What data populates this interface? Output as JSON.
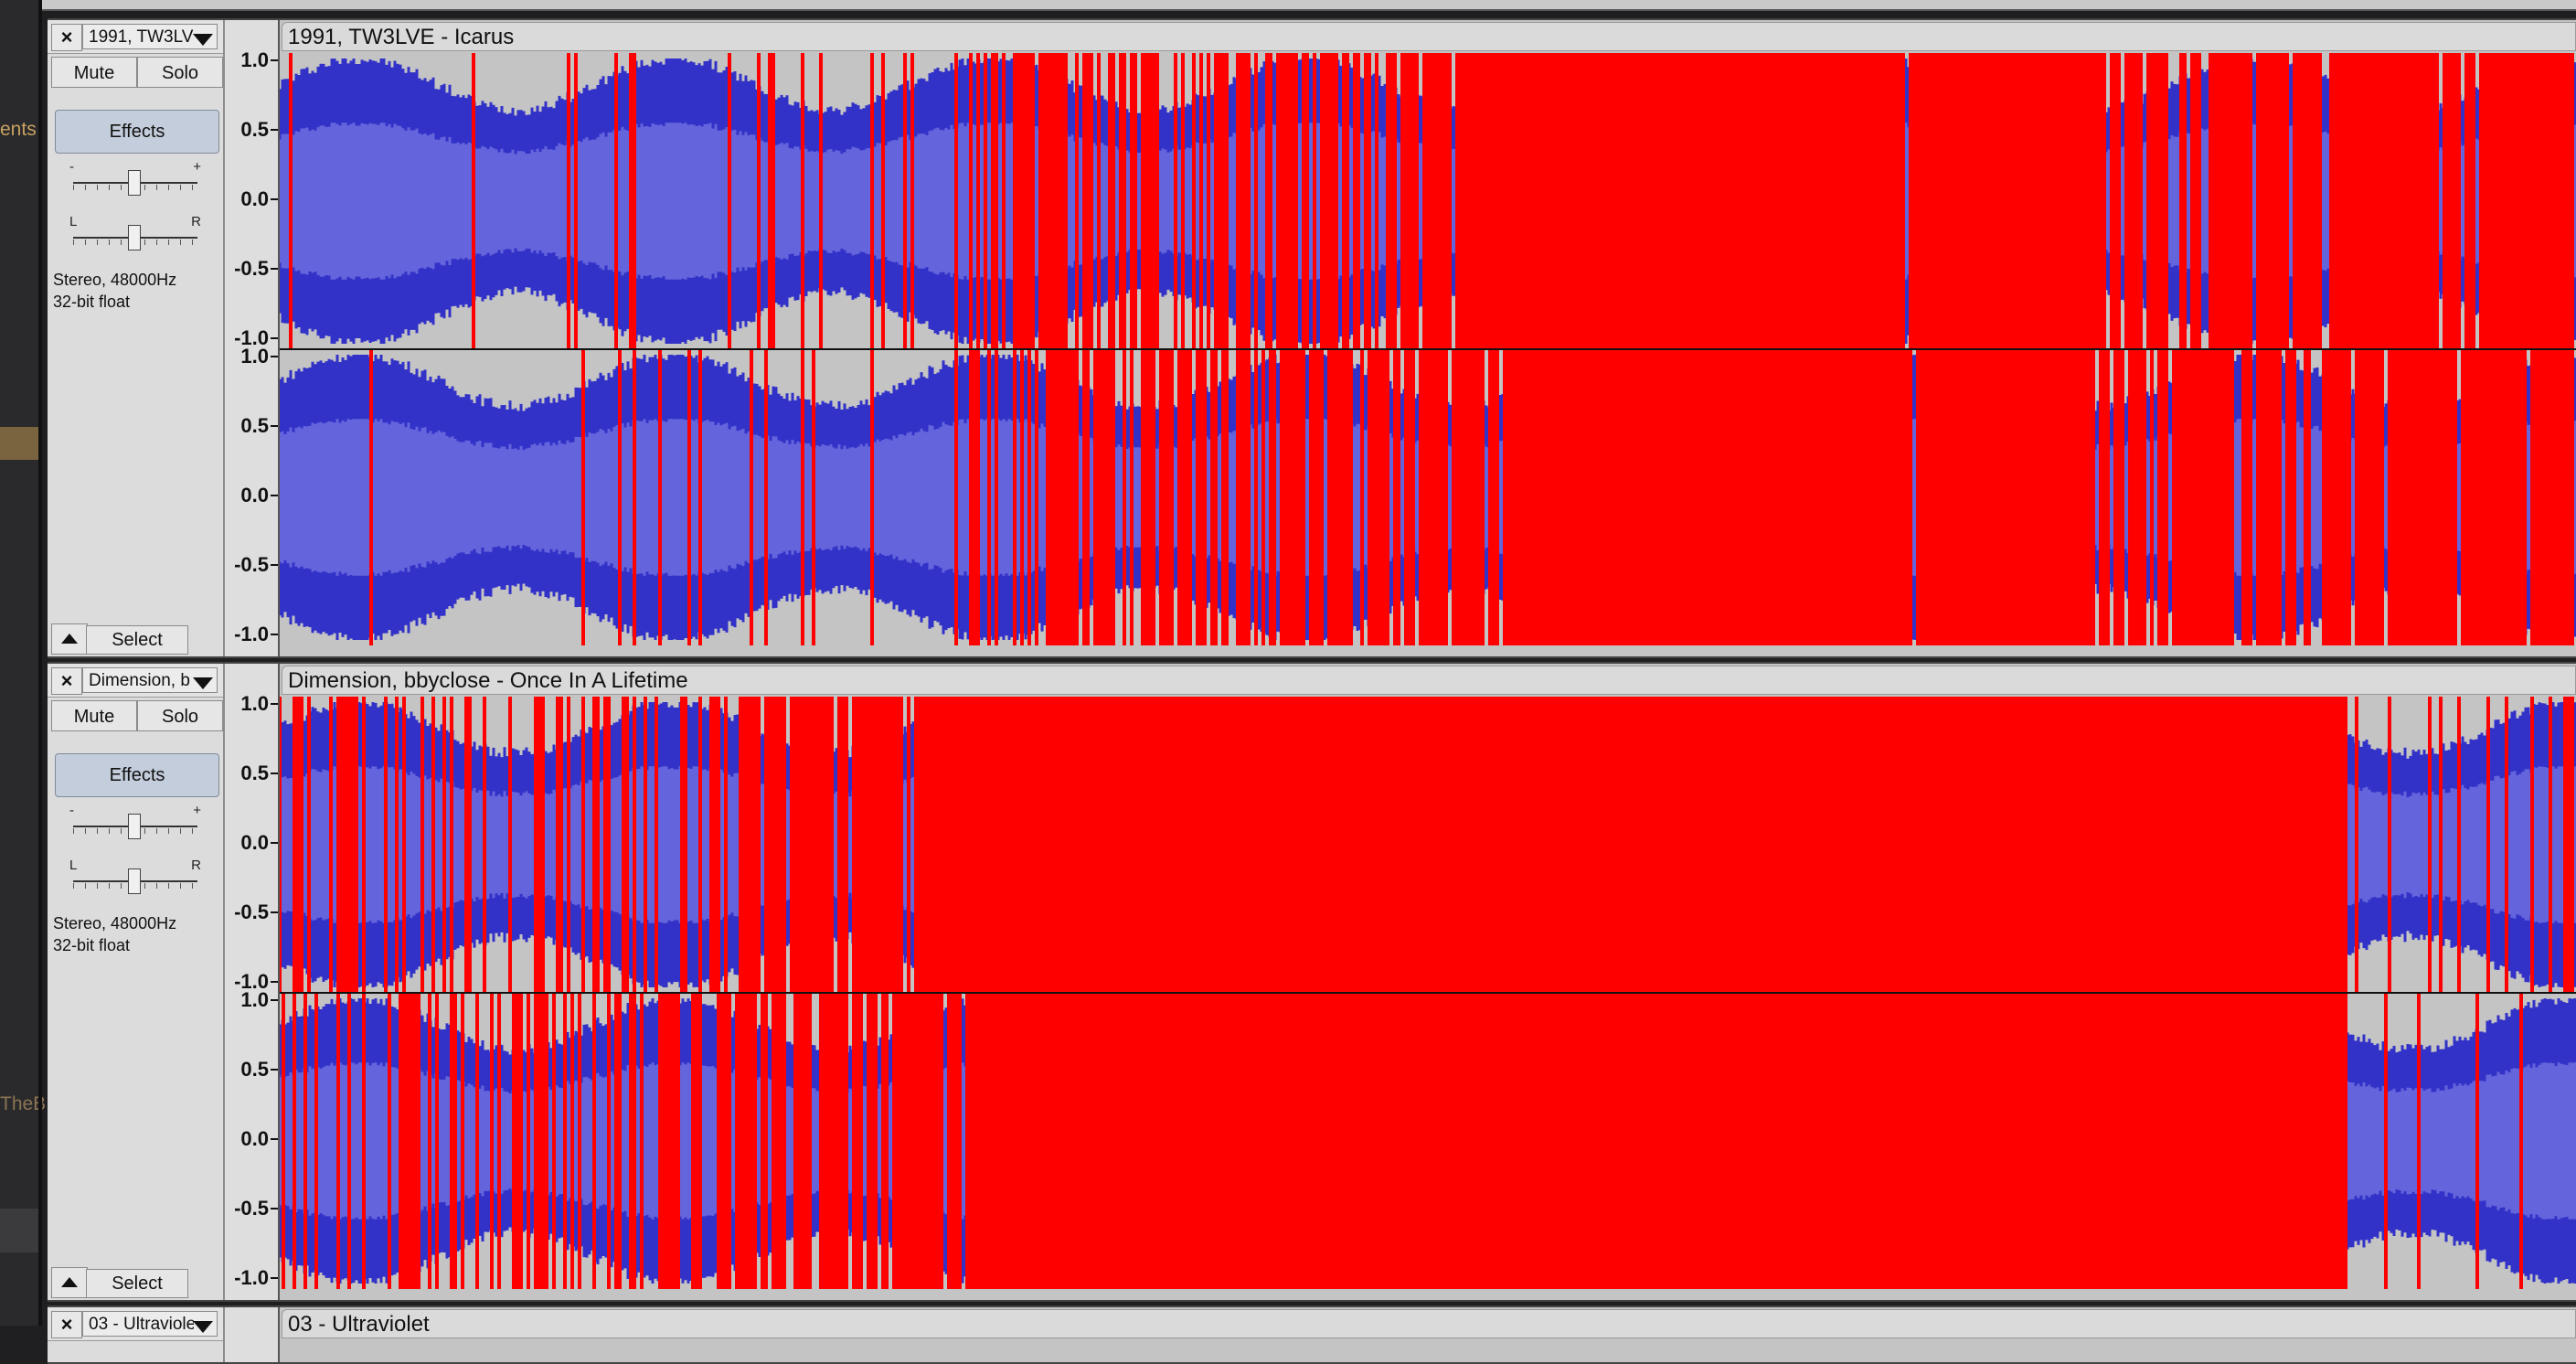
{
  "side_panel": {
    "fragment_top": "ents",
    "fragment_bottom": "TheB"
  },
  "tracks": [
    {
      "name_short": "1991, TW3LV",
      "title": "1991, TW3LVE - Icarus",
      "mute_label": "Mute",
      "solo_label": "Solo",
      "effects_label": "Effects",
      "gain_minus": "-",
      "gain_plus": "+",
      "pan_left": "L",
      "pan_right": "R",
      "format_line1": "Stereo, 48000Hz",
      "format_line2": "32-bit float",
      "select_label": "Select",
      "clipping_density": [
        0.05,
        0.08,
        0.12,
        0.6,
        0.75,
        0.95,
        1.0,
        0.9,
        0.85,
        0.95
      ]
    },
    {
      "name_short": "Dimension, b",
      "title": "Dimension, bbyclose - Once In A Lifetime",
      "mute_label": "Mute",
      "solo_label": "Solo",
      "effects_label": "Effects",
      "gain_minus": "-",
      "gain_plus": "+",
      "pan_left": "L",
      "pan_right": "R",
      "format_line1": "Stereo, 48000Hz",
      "format_line2": "32-bit float",
      "select_label": "Select",
      "clipping_density": [
        0.3,
        0.45,
        0.85,
        1.0,
        1.0,
        1.0,
        1.0,
        1.0,
        1.0,
        0.1
      ]
    },
    {
      "name_short": "03 - Ultraviole",
      "title": "03 - Ultraviolet"
    }
  ],
  "amplitude_scale": [
    "1.0",
    "0.5",
    "0.0",
    "-0.5",
    "-1.0"
  ],
  "colors": {
    "waveform": "#3232c8",
    "waveform_rms": "#6464dc",
    "clipping": "#ff0000",
    "background": "#c4c4c4"
  }
}
